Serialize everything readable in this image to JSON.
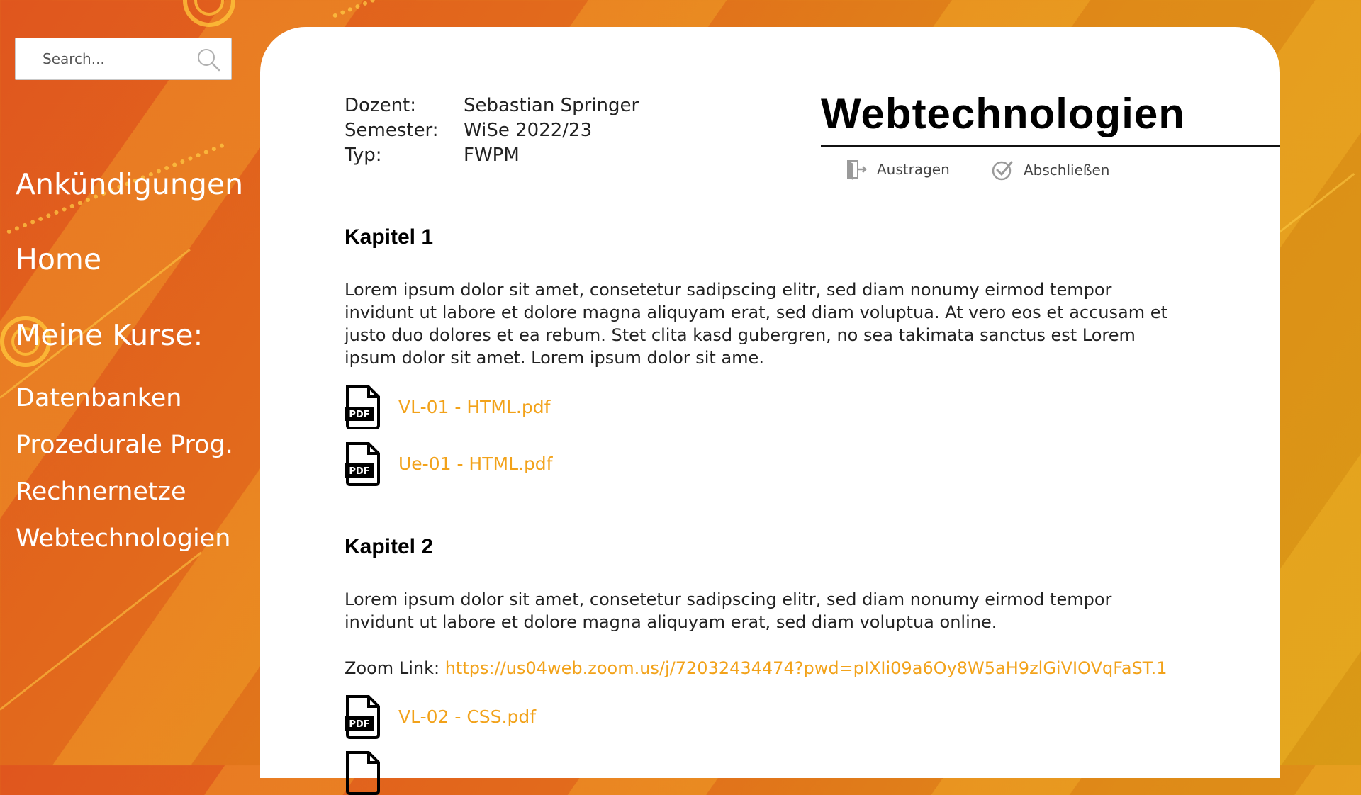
{
  "search": {
    "placeholder": "Search..."
  },
  "sidebar": {
    "nav_items": [
      {
        "label": "Ankündigungen"
      },
      {
        "label": "Home"
      }
    ],
    "my_courses_heading": "Meine Kurse:",
    "courses": [
      {
        "label": "Datenbanken"
      },
      {
        "label": "Prozedurale Prog."
      },
      {
        "label": "Rechnernetze"
      },
      {
        "label": "Webtechnologien"
      }
    ]
  },
  "course": {
    "title": "Webtechnologien",
    "meta": [
      {
        "label": "Dozent:",
        "value": "Sebastian Springer"
      },
      {
        "label": "Semester:",
        "value": "WiSe 2022/23"
      },
      {
        "label": "Typ:",
        "value": "FWPM"
      }
    ],
    "actions": [
      {
        "label": "Austragen",
        "icon": "exit-door-icon"
      },
      {
        "label": "Abschließen",
        "icon": "check-circle-icon"
      }
    ]
  },
  "chapters": [
    {
      "title": "Kapitel 1",
      "text": "Lorem ipsum dolor sit amet, consetetur sadipscing elitr, sed diam nonumy eirmod tempor invidunt ut labore et dolore magna aliquyam erat, sed diam voluptua. At vero eos et accusam et justo duo dolores et ea rebum. Stet clita kasd gubergren, no sea takimata sanctus est Lorem ipsum dolor sit amet. Lorem ipsum dolor sit ame.",
      "files": [
        {
          "name": "VL-01 - HTML.pdf",
          "icon_label": "PDF"
        },
        {
          "name": "Ue-01 - HTML.pdf",
          "icon_label": "PDF"
        }
      ]
    },
    {
      "title": "Kapitel 2",
      "text": "Lorem ipsum dolor sit amet, consetetur sadipscing elitr, sed diam nonumy eirmod tempor invidunt ut labore et dolore magna aliquyam erat, sed diam voluptua online.",
      "zoom_label": "Zoom Link: ",
      "zoom_url": "https://us04web.zoom.us/j/72032434474?pwd=pIXIi09a6Oy8W5aH9zlGiVIOVqFaST.1",
      "files": [
        {
          "name": "VL-02 - CSS.pdf",
          "icon_label": "PDF"
        }
      ]
    }
  ],
  "colors": {
    "link": "#f2a21a",
    "background_primary": "#e0561e",
    "background_secondary": "#d99a16",
    "card": "#ffffff"
  }
}
